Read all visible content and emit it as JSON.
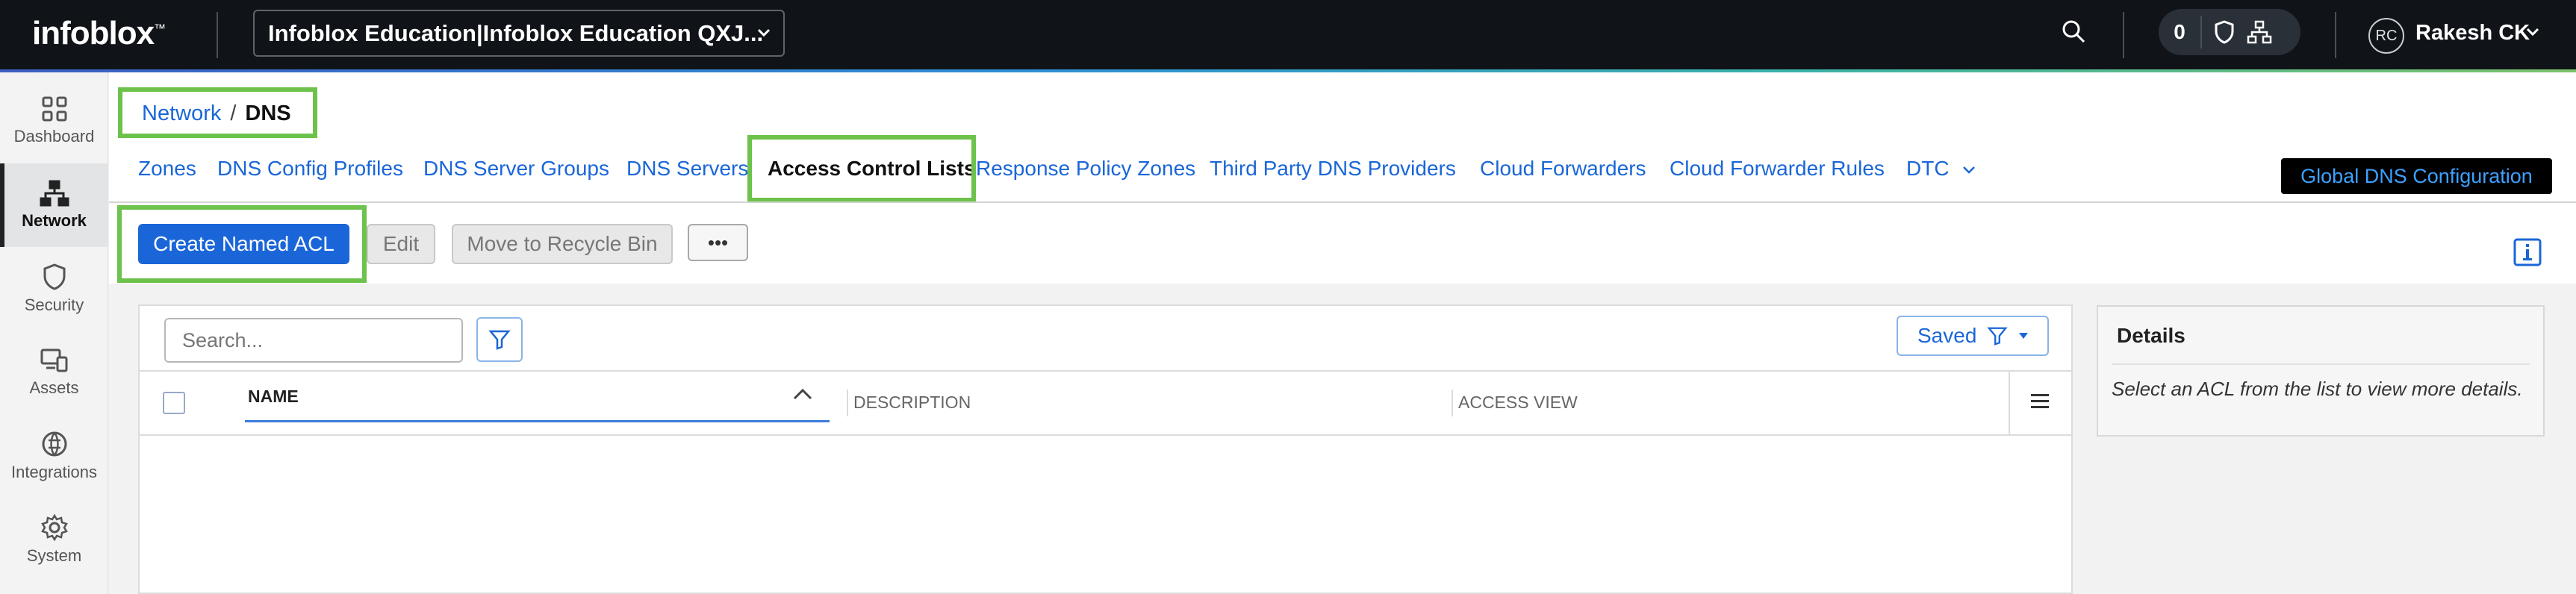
{
  "app": {
    "logo_text": "infoblox",
    "tenant_label": "Infoblox Education|Infoblox Education QXJ..."
  },
  "topbar": {
    "notification_count": "0",
    "user_initials": "RC",
    "user_name": "Rakesh CK"
  },
  "sidebar": {
    "items": [
      {
        "label": "Dashboard",
        "icon": "dashboard-grid-icon"
      },
      {
        "label": "Network",
        "icon": "network-icon",
        "active": true
      },
      {
        "label": "Security",
        "icon": "shield-icon"
      },
      {
        "label": "Assets",
        "icon": "assets-icon"
      },
      {
        "label": "Integrations",
        "icon": "integrations-icon"
      },
      {
        "label": "System",
        "icon": "gear-icon"
      }
    ]
  },
  "breadcrumb": {
    "parent": "Network",
    "separator": "/",
    "current": "DNS"
  },
  "tabs": [
    {
      "label": "Zones"
    },
    {
      "label": "DNS Config Profiles"
    },
    {
      "label": "DNS Server Groups"
    },
    {
      "label": "DNS Servers"
    },
    {
      "label": "Access Control Lists",
      "active": true
    },
    {
      "label": "Response Policy Zones"
    },
    {
      "label": "Third Party DNS Providers"
    },
    {
      "label": "Cloud Forwarders"
    },
    {
      "label": "Cloud Forwarder Rules"
    },
    {
      "label": "DTC"
    }
  ],
  "global_config_label": "Global DNS Configuration",
  "toolbar": {
    "create_label": "Create Named ACL",
    "edit_label": "Edit",
    "recycle_label": "Move to Recycle Bin",
    "more_label": "•••"
  },
  "grid": {
    "search_placeholder": "Search...",
    "saved_label": "Saved",
    "columns": [
      "NAME",
      "DESCRIPTION",
      "ACCESS VIEW"
    ]
  },
  "details": {
    "title": "Details",
    "text": "Select an ACL from the list to view more details."
  },
  "colors": {
    "accent_blue": "#1a66d8",
    "highlight_green": "#6cc24a",
    "topbar_bg": "#101418"
  }
}
